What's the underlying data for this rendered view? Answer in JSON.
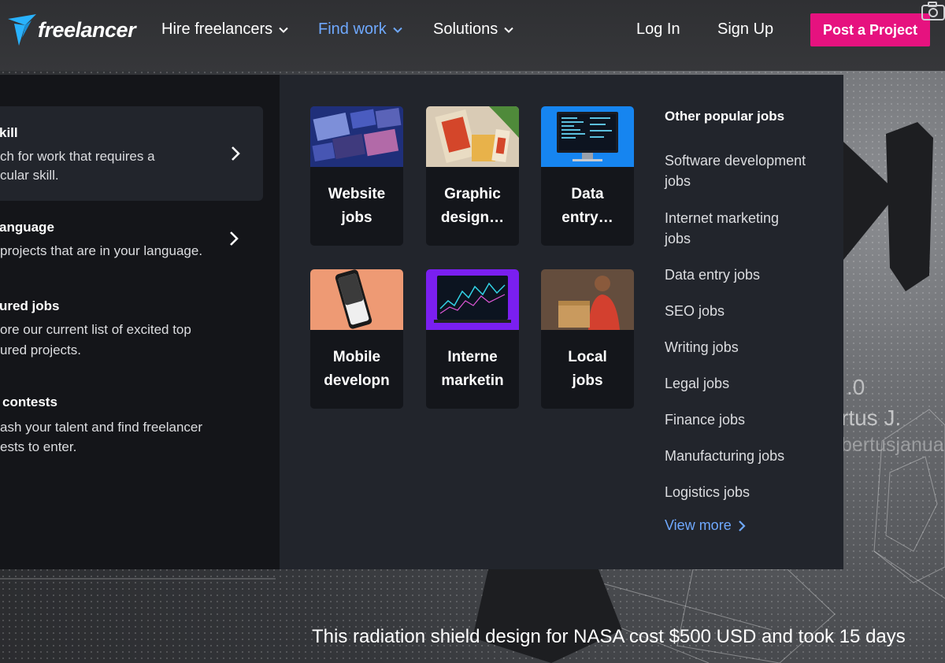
{
  "header": {
    "logo_text": "freelancer",
    "nav": [
      {
        "label": "Hire freelancers"
      },
      {
        "label": "Find work"
      },
      {
        "label": "Solutions"
      }
    ],
    "login_label": "Log In",
    "signup_label": "Sign Up",
    "post_project_label": "Post a Project"
  },
  "find_work_menu": {
    "options": [
      {
        "title": "kill",
        "desc_lines": [
          "ch for work that requires a",
          "cular skill."
        ]
      },
      {
        "title": "anguage",
        "desc_lines": [
          "projects that are in your language."
        ]
      },
      {
        "title": "ured jobs",
        "desc_lines": [
          "ore our current list of excited top",
          "ured projects."
        ]
      },
      {
        "title": "contests",
        "desc_lines": [
          "ash your talent and find freelancer",
          "ests to enter."
        ]
      }
    ],
    "job_cards": [
      {
        "line1": "Website",
        "line2": "jobs"
      },
      {
        "line1": "Graphic",
        "line2": "design…"
      },
      {
        "line1": "Data",
        "line2": "entry…"
      },
      {
        "line1": "Mobile",
        "line2": "developn"
      },
      {
        "line1": "Interne",
        "line2": "marketin"
      },
      {
        "line1": "Local",
        "line2": "jobs"
      }
    ],
    "popular": {
      "title": "Other popular jobs",
      "links": [
        {
          "line1": "Software development",
          "line2": "jobs"
        },
        {
          "line1": "Internet marketing",
          "line2": "jobs"
        },
        {
          "line1": "Data entry jobs",
          "line2": ""
        },
        {
          "line1": "SEO jobs",
          "line2": ""
        },
        {
          "line1": "Writing jobs",
          "line2": ""
        },
        {
          "line1": "Legal jobs",
          "line2": ""
        },
        {
          "line1": "Finance jobs",
          "line2": ""
        },
        {
          "line1": "Manufacturing jobs",
          "line2": ""
        },
        {
          "line1": "Logistics jobs",
          "line2": ""
        }
      ],
      "view_more_label": "View more"
    }
  },
  "hero": {
    "rating_fragment": ".0",
    "name_fragment": "rtus J.",
    "handle_fragment": "bertusjanua",
    "caption": "This radiation shield design for NASA cost $500 USD and took 15 days"
  },
  "colors": {
    "accent_pink": "#e6127f",
    "active_link_blue": "#6fa9ff",
    "logo_blue": "#29b2fe"
  }
}
